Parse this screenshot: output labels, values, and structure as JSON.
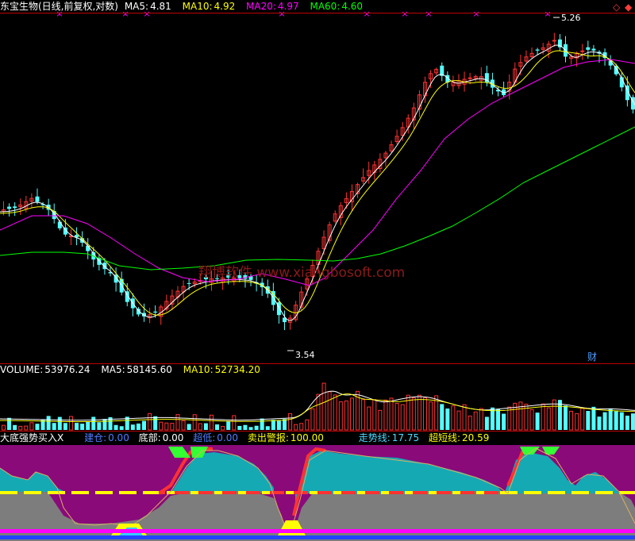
{
  "price_header": {
    "title": "东宝生物(日线,前复权,对数)",
    "ma5_label": "MA5:",
    "ma5": "4.81",
    "ma10_label": "MA10:",
    "ma10": "4.92",
    "ma20_label": "MA20:",
    "ma20": "4.97",
    "ma60_label": "MA60:",
    "ma60": "4.60"
  },
  "price_panel": {
    "high_label": "5.26",
    "low_label": "3.54",
    "finance_badge": "财",
    "watermark": "翔博软件 www.xiangbosoft.com",
    "marker_glyph": "×"
  },
  "volume_header": {
    "volume_label": "VOLUME:",
    "volume": "53976.24",
    "ma5_label": "MA5:",
    "ma5": "58145.60",
    "ma10_label": "MA10:",
    "ma10": "52734.20"
  },
  "indicator_header": {
    "name": "大底强势买入X",
    "jiancang_label": "建仓:",
    "jiancang": "0.00",
    "dibu_label": "底部:",
    "dibu": "0.00",
    "chaodi_label": "超低:",
    "chaodi": "0.00",
    "maichu_label": "卖出警报:",
    "maichu": "100.00",
    "zoushi_label": "走势线:",
    "zoushi": "17.75",
    "chaoduan_label": "超短线:",
    "chaoduan": "20.59"
  },
  "toolbar": {
    "toggle_icon": "◇",
    "menu_icon": "◆"
  },
  "colors": {
    "up": "#ff3232",
    "down": "#54ffff",
    "ma5": "#ffffff",
    "ma10": "#ffff00",
    "ma20": "#ff00ff",
    "ma60": "#00ff00",
    "separator": "#c00000",
    "magenta_fill": "#8a0a7a",
    "cyan_fill": "#15a9b4",
    "gray_fill": "#7d7d7d"
  }
}
